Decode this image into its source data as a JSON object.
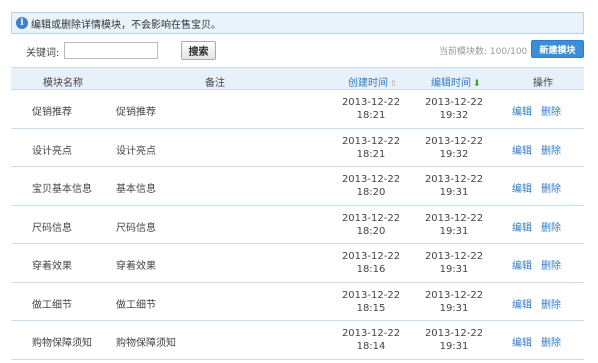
{
  "notice": {
    "icon": "info-icon",
    "text": "编辑或删除详情模块，不会影响在售宝贝。"
  },
  "toolbar": {
    "keyword_label": "关键词:",
    "keyword_value": "",
    "keyword_placeholder": "",
    "search_label": "搜索",
    "quota_text": "当前模块数: 100/100",
    "new_module_label": "新建模块"
  },
  "table": {
    "headers": {
      "name": "模块名称",
      "note": "备注",
      "created": "创建时间",
      "edited": "编辑时间",
      "actions": "操作"
    },
    "edit_label": "编辑",
    "delete_label": "删除",
    "rows": [
      {
        "name": "促销推荐",
        "note": "促销推荐",
        "created_date": "2013-12-22",
        "created_time": "18:21",
        "edited_date": "2013-12-22",
        "edited_time": "19:32"
      },
      {
        "name": "设计亮点",
        "note": "设计亮点",
        "created_date": "2013-12-22",
        "created_time": "18:21",
        "edited_date": "2013-12-22",
        "edited_time": "19:32"
      },
      {
        "name": "宝贝基本信息",
        "note": "基本信息",
        "created_date": "2013-12-22",
        "created_time": "18:20",
        "edited_date": "2013-12-22",
        "edited_time": "19:31"
      },
      {
        "name": "尺码信息",
        "note": "尺码信息",
        "created_date": "2013-12-22",
        "created_time": "18:20",
        "edited_date": "2013-12-22",
        "edited_time": "19:31"
      },
      {
        "name": "穿着效果",
        "note": "穿着效果",
        "created_date": "2013-12-22",
        "created_time": "18:16",
        "edited_date": "2013-12-22",
        "edited_time": "19:31"
      },
      {
        "name": "做工细节",
        "note": "做工细节",
        "created_date": "2013-12-22",
        "created_time": "18:15",
        "edited_date": "2013-12-22",
        "edited_time": "19:31"
      },
      {
        "name": "购物保障须知",
        "note": "购物保障须知",
        "created_date": "2013-12-22",
        "created_time": "18:14",
        "edited_date": "2013-12-22",
        "edited_time": "19:31"
      }
    ]
  },
  "colors": {
    "accent": "#2f7bc6",
    "primary_button": "#3b8fd9",
    "header_bg": "#e8f1fa",
    "notice_bg": "#e8f3fc"
  }
}
